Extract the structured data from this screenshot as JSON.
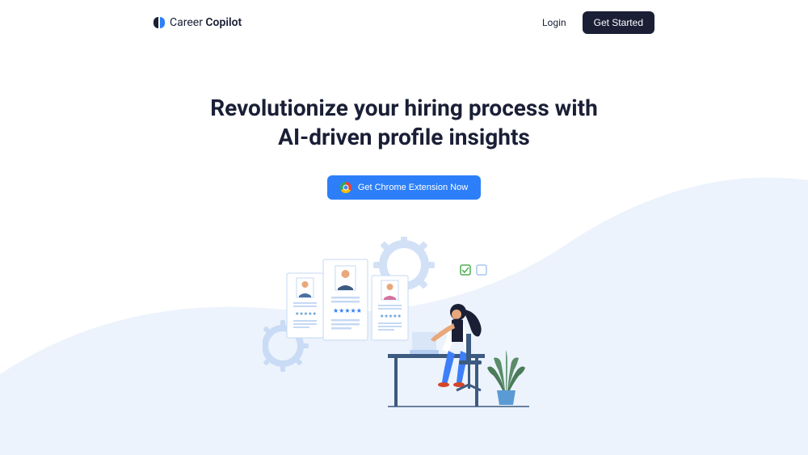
{
  "logo": {
    "text_regular": "Career ",
    "text_bold": "Copilot"
  },
  "nav": {
    "login_label": "Login",
    "get_started_label": "Get Started"
  },
  "hero": {
    "title_line1": "Revolutionize your hiring process with",
    "title_line2": "AI-driven profile insights",
    "cta_label": "Get Chrome Extension Now"
  }
}
